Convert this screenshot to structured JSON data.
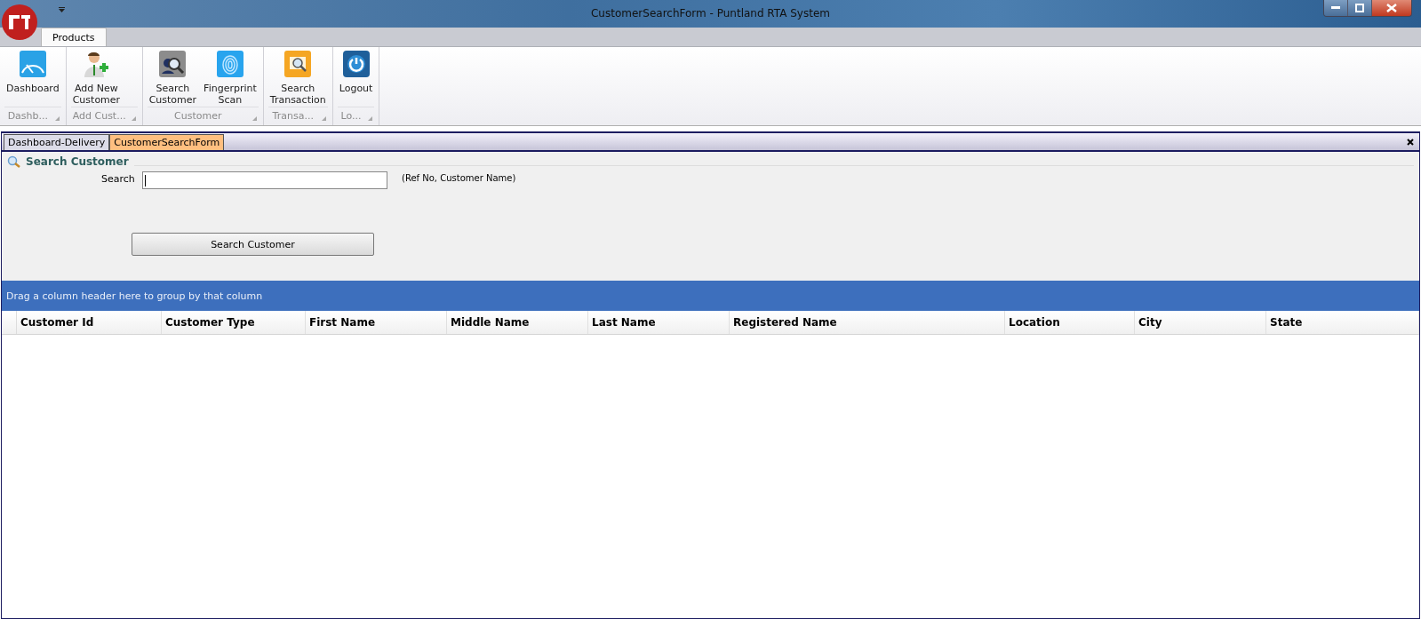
{
  "window": {
    "title": "CustomerSearchForm - Puntland RTA System"
  },
  "ribbon_tabs": [
    {
      "label": "Products",
      "selected": true
    }
  ],
  "ribbon_groups": [
    {
      "label": "Dashb...",
      "buttons": [
        {
          "label": "Dashboard",
          "kind": "dashboard"
        }
      ]
    },
    {
      "label": "Add Cust...",
      "buttons": [
        {
          "label": "Add New\nCustomer",
          "kind": "add-user"
        }
      ]
    },
    {
      "label": "Customer",
      "buttons": [
        {
          "label": "Search\nCustomer",
          "kind": "search-user"
        },
        {
          "label": "Fingerprint\nScan",
          "kind": "fingerprint"
        }
      ]
    },
    {
      "label": "Transa...",
      "buttons": [
        {
          "label": "Search\nTransaction",
          "kind": "search-doc"
        }
      ]
    },
    {
      "label": "Lo...",
      "buttons": [
        {
          "label": "Logout",
          "kind": "logout"
        }
      ]
    }
  ],
  "document_tabs": [
    {
      "label": "Dashboard-Delivery",
      "selected": false
    },
    {
      "label": "CustomerSearchForm",
      "selected": true
    }
  ],
  "form": {
    "title": "Search Customer",
    "search_label": "Search",
    "search_hint": "(Ref No, Customer Name)",
    "button": "Search Customer"
  },
  "grid": {
    "group_panel": "Drag a column header here to group by that column",
    "columns": [
      "Customer Id",
      "Customer Type",
      "First Name",
      "Middle Name",
      "Last Name",
      "Registered Name",
      "Location",
      "City",
      "State"
    ]
  }
}
